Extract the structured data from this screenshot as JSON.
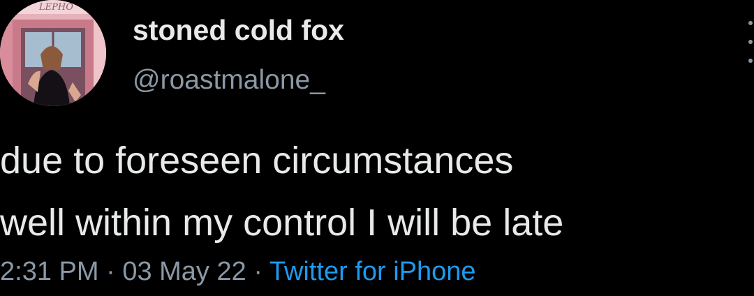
{
  "author": {
    "display_name": "stoned cold fox",
    "handle": "@roastmalone_",
    "avatar_sign_text": "LEPHO"
  },
  "tweet": {
    "lines": [
      "due to foreseen circumstances",
      "well within my control I will be late"
    ]
  },
  "meta": {
    "time": "2:31 PM",
    "separator": "·",
    "date": "03 May 22",
    "source": "Twitter for iPhone"
  },
  "colors": {
    "background": "#000000",
    "primary_text": "#e7e9ea",
    "secondary_text": "#8b98a5",
    "link": "#1d9bf0"
  },
  "icons": [
    "more-options-icon"
  ]
}
